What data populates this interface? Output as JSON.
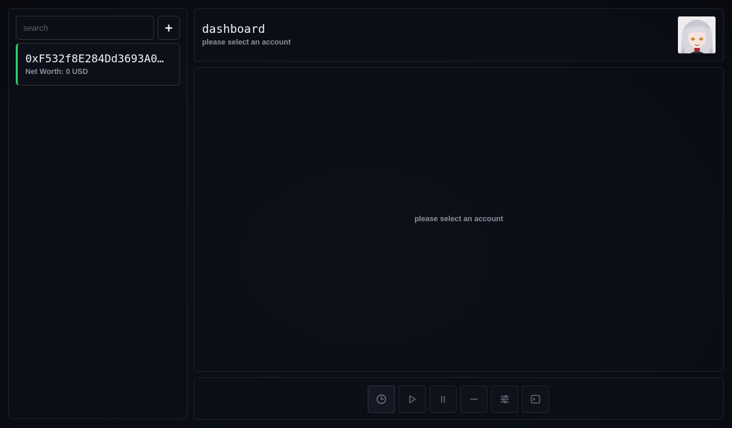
{
  "sidebar": {
    "search": {
      "placeholder": "search",
      "value": ""
    },
    "add_button_label": "+",
    "accounts": [
      {
        "address": "0xF532f8E284Dd3693A0…",
        "net_worth": "Net Worth: 0 USD",
        "status_color": "#35c46a"
      }
    ]
  },
  "header": {
    "title": "dashboard",
    "subtitle": "please select an account",
    "avatar_icon": "anime-avatar"
  },
  "main": {
    "empty_message": "please select an account"
  },
  "toolbar": {
    "buttons": [
      {
        "icon": "clock-icon",
        "active": true
      },
      {
        "icon": "play-icon",
        "active": false
      },
      {
        "icon": "pause-icon",
        "active": false
      },
      {
        "icon": "minus-icon",
        "active": false
      },
      {
        "icon": "sliders-icon",
        "active": false
      },
      {
        "icon": "terminal-icon",
        "active": false
      }
    ]
  },
  "colors": {
    "background": "#0a0d14",
    "panel_border": "#1c212c",
    "accent_green": "#35c46a",
    "muted_text": "#8a8f9c",
    "icon": "#6f7482"
  }
}
